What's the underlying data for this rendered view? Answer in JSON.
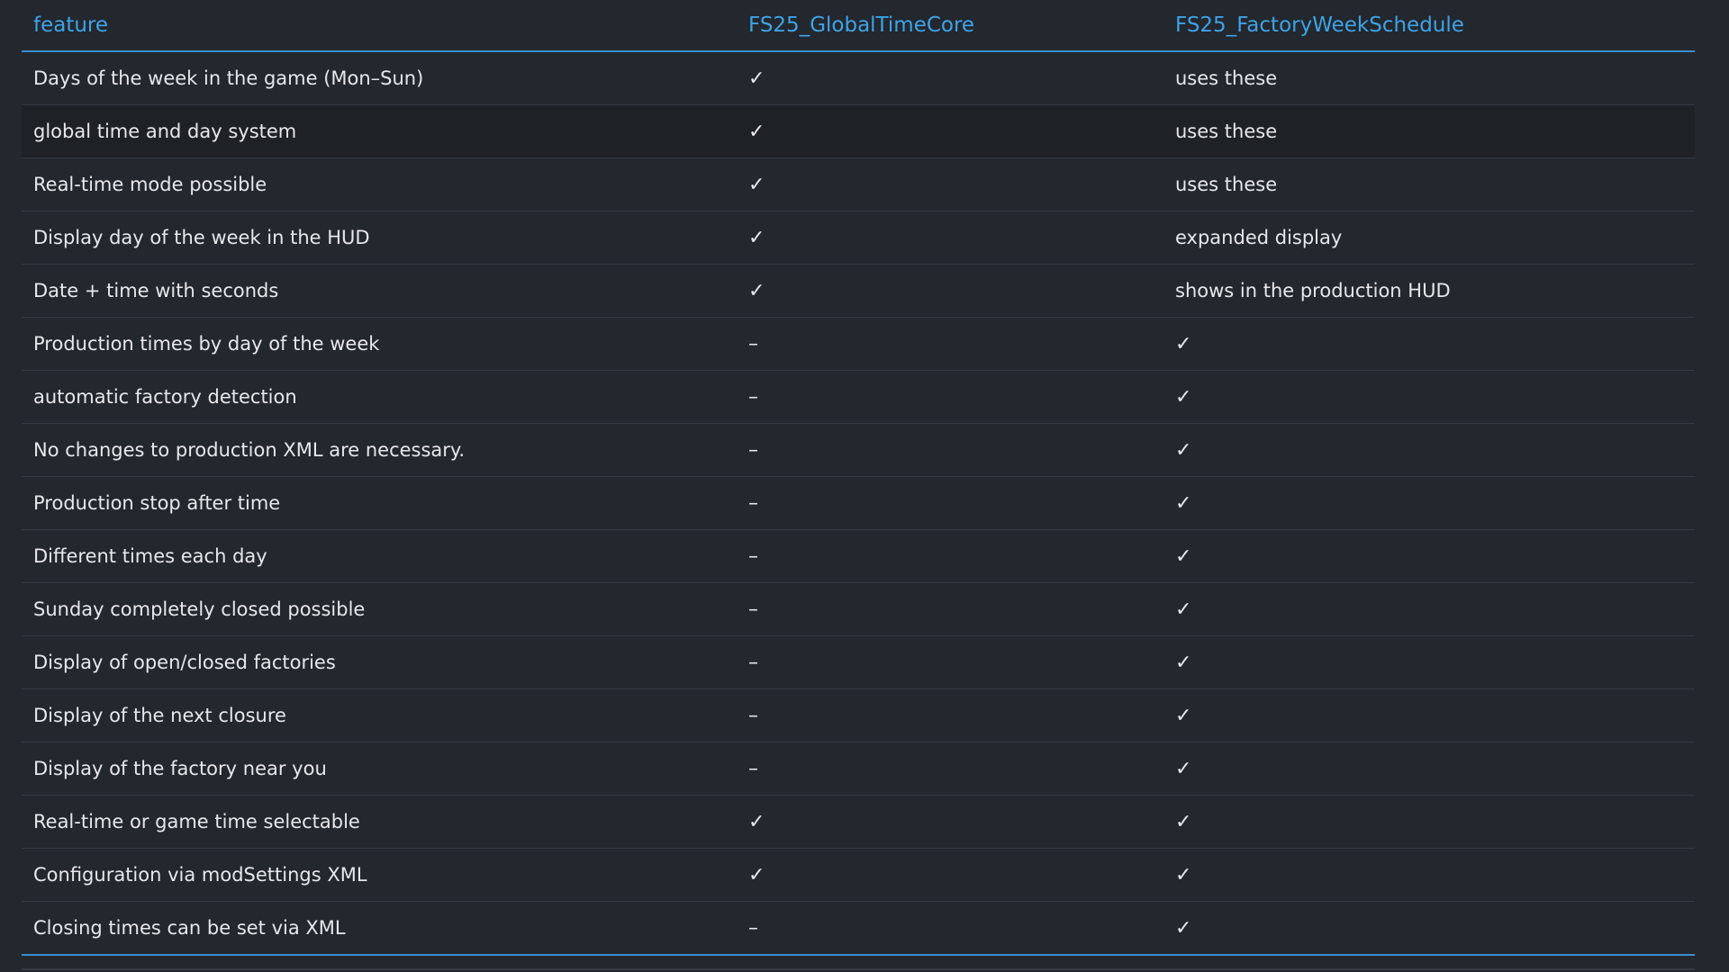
{
  "table": {
    "headers": [
      "feature",
      "FS25_GlobalTimeCore",
      "FS25_FactoryWeekSchedule"
    ],
    "rows": [
      [
        "Days of the week in the game (Mon–Sun)",
        "✓",
        "uses these"
      ],
      [
        "global time and day system",
        "✓",
        "uses these"
      ],
      [
        "Real-time mode possible",
        "✓",
        "uses these"
      ],
      [
        "Display day of the week in the HUD",
        "✓",
        "expanded display"
      ],
      [
        "Date + time with seconds",
        "✓",
        "shows in the production HUD"
      ],
      [
        "Production times by day of the week",
        "–",
        "✓"
      ],
      [
        "automatic factory detection",
        "–",
        "✓"
      ],
      [
        "No changes to production XML are necessary.",
        "–",
        "✓"
      ],
      [
        "Production stop after time",
        "–",
        "✓"
      ],
      [
        "Different times each day",
        "–",
        "✓"
      ],
      [
        "Sunday completely closed possible",
        "–",
        "✓"
      ],
      [
        "Display of open/closed factories",
        "–",
        "✓"
      ],
      [
        "Display of the next closure",
        "–",
        "✓"
      ],
      [
        "Display of the factory near you",
        "–",
        "✓"
      ],
      [
        "Real-time or game time selectable",
        "✓",
        "✓"
      ],
      [
        "Configuration via modSettings XML",
        "✓",
        "✓"
      ],
      [
        "Closing times can be set via XML",
        "–",
        "✓"
      ]
    ]
  },
  "colors": {
    "background": "#23272e",
    "header_text": "#3fa3e6",
    "accent_line": "#3a8fd0",
    "row_highlight": "#1e2126"
  }
}
